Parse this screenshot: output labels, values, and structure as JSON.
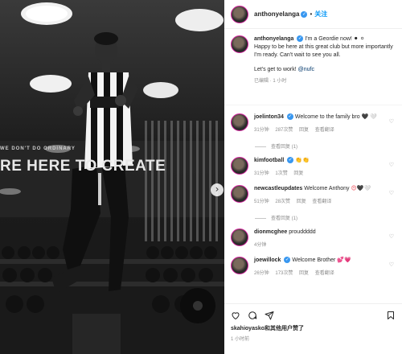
{
  "post": {
    "username": "anthonyelanga",
    "follow_label": "关注",
    "dot": "•",
    "caption_line1": "I'm a Geordie now! ⚫ ⚪",
    "caption_line2": "Happy to be here at this great club but more importantly I'm ready. Can't wait to see you all.",
    "caption_line3": "Let's get to work! ",
    "caption_mention": "@nufc",
    "caption_meta": "已编辑 · 1 小时",
    "photo_wall_small": "WE DON'T DO ORDINARY",
    "photo_wall_big": "RE HERE TO CREATE"
  },
  "comments": [
    {
      "user": "joelinton34",
      "text": "Welcome to the family bro ",
      "emoji": "🖤 🤍",
      "time": "31分钟",
      "likes": "287次赞",
      "reply": "回复",
      "translate": "查看翻译",
      "replies": "查看回复 (1)"
    },
    {
      "user": "kimfootball",
      "text": "👏👏",
      "emoji": "",
      "time": "31分钟",
      "likes": "1次赞",
      "reply": "回复",
      "translate": "",
      "replies": ""
    },
    {
      "user": "newcastleupdates",
      "text": "Welcome Anthony ",
      "emoji": "😍🖤🤍",
      "time": "51分钟",
      "likes": "28次赞",
      "reply": "回复",
      "translate": "查看翻译",
      "replies": "查看回复 (1)"
    },
    {
      "user": "dionmcghee",
      "text": "prouddddd",
      "emoji": "",
      "time": "4分钟",
      "likes": "",
      "reply": "",
      "translate": "",
      "replies": ""
    },
    {
      "user": "joewillock",
      "text": "Welcome Brother ",
      "emoji": "💕💗",
      "time": "26分钟",
      "likes": "173次赞",
      "reply": "回复",
      "translate": "查看翻译",
      "replies": ""
    }
  ],
  "footer": {
    "liked_by": "skahioyasko和其他用户赞了",
    "time": "1 小时前"
  },
  "icons": {
    "verified": "verified-badge-icon",
    "heart": "heart-icon",
    "comment": "comment-icon",
    "share": "share-icon",
    "save": "bookmark-icon",
    "next": "chevron-right-icon"
  }
}
